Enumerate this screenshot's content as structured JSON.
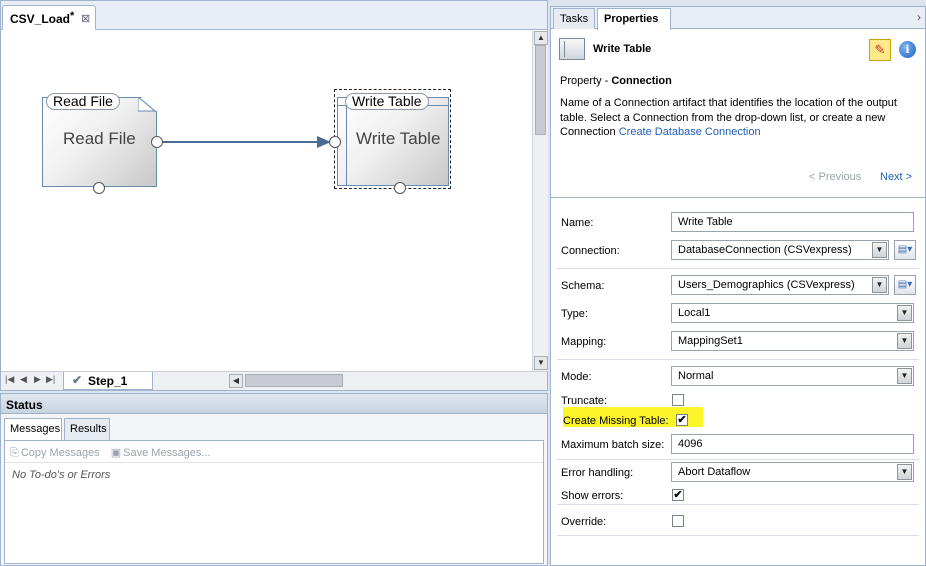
{
  "editor": {
    "tab_title": "CSV_Load",
    "tab_dirty": "*",
    "canvas": {
      "read_node": {
        "title": "Read File",
        "body": "Read File"
      },
      "write_node": {
        "title": "Write Table",
        "body": "Write Table"
      }
    },
    "step_tab": "Step_1"
  },
  "status": {
    "header": "Status",
    "tabs": [
      "Messages",
      "Results"
    ],
    "toolbar": {
      "copy": "Copy Messages",
      "save": "Save Messages..."
    },
    "message": "No To-do's or Errors"
  },
  "properties": {
    "tabs": [
      "Tasks",
      "Properties"
    ],
    "header_title": "Write Table",
    "property_prefix": "Property - ",
    "property_name": "Connection",
    "description": "Name of a Connection artifact that identifies the location of the output table.  Select a Connection from the drop-down list, or create a new Connection ",
    "create_link": "Create Database Connection",
    "prev": "< Previous",
    "next": "Next >",
    "fields": {
      "name": {
        "label": "Name:",
        "value": "Write Table"
      },
      "connection": {
        "label": "Connection:",
        "value": "DatabaseConnection (CSVexpress)"
      },
      "schema": {
        "label": "Schema:",
        "value": "Users_Demographics (CSVexpress)"
      },
      "type": {
        "label": "Type:",
        "value": "Local1"
      },
      "mapping": {
        "label": "Mapping:",
        "value": "MappingSet1"
      },
      "mode": {
        "label": "Mode:",
        "value": "Normal"
      },
      "truncate": {
        "label": "Truncate:",
        "checked": false
      },
      "create_missing_table": {
        "label": "Create Missing Table:",
        "checked": true
      },
      "max_batch_size": {
        "label": "Maximum batch size:",
        "value": "4096"
      },
      "error_handling": {
        "label": "Error handling:",
        "value": "Abort Dataflow"
      },
      "show_errors": {
        "label": "Show errors:",
        "checked": true
      },
      "override": {
        "label": "Override:",
        "checked": false
      }
    },
    "highlight_color": "#fbf52a"
  }
}
